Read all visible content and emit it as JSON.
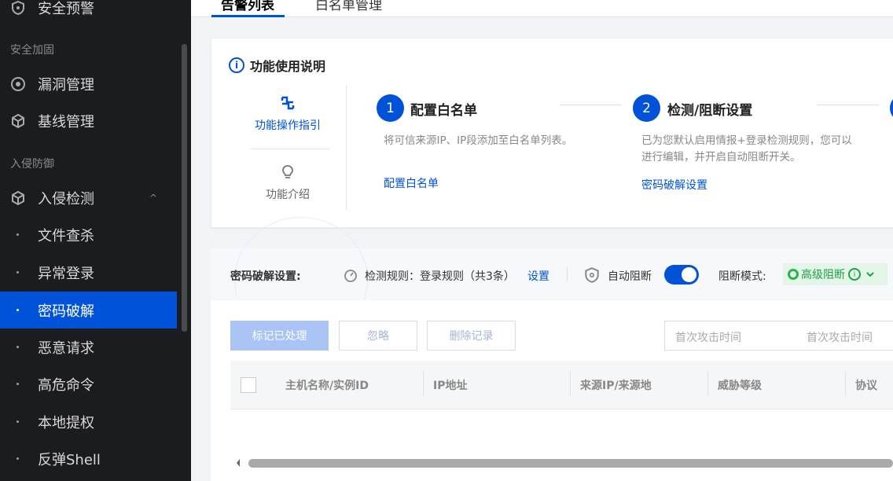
{
  "sidebar": {
    "top_item": "安全预警",
    "group_hardening": "安全加固",
    "vuln": "漏洞管理",
    "baseline": "基线管理",
    "group_defense": "入侵防御",
    "intrusion": "入侵检测",
    "caret": "^",
    "sub_items": [
      "文件查杀",
      "异常登录",
      "密码破解",
      "恶意请求",
      "高危命令",
      "本地提权",
      "反弹Shell"
    ]
  },
  "tabs": {
    "alerts": "告警列表",
    "whitelist": "白名单管理"
  },
  "help": {
    "title": "功能使用说明",
    "info_glyph": "i",
    "nav_guide": "功能操作指引",
    "nav_intro": "功能介绍",
    "step1": {
      "num": "1",
      "title": "配置白名单",
      "desc": "将可信来源IP、IP段添加至白名单列表。",
      "link": "配置白名单"
    },
    "step2": {
      "num": "2",
      "title": "检测/阻断设置",
      "desc_line1": "已为您默认启用情报+登录检测规则，您可以",
      "desc_line2": "进行编辑，并开启自动阻断开关。",
      "link": "密码破解设置"
    }
  },
  "settings": {
    "label": "密码破解设置:",
    "rule_label": "检测规则：登录规则（共3条）",
    "rule_link": "设置",
    "auto_block": "自动阻断",
    "auto_block_on": true,
    "mode_label": "阻断模式:",
    "mode_value": "高级阻断",
    "mode_info": "i"
  },
  "toolbar": {
    "mark_done": "标记已处理",
    "ignore": "忽略",
    "delete": "删除记录",
    "date_start_placeholder": "首次攻击时间",
    "date_end_placeholder": "首次攻击时间"
  },
  "table": {
    "columns": [
      "主机名称/实例ID",
      "IP地址",
      "来源IP/来源地",
      "威胁等级",
      "协议"
    ]
  },
  "colors": {
    "accent": "#0052d9",
    "sidebar_bg": "#1b1c1f",
    "success": "#1fa04a"
  }
}
